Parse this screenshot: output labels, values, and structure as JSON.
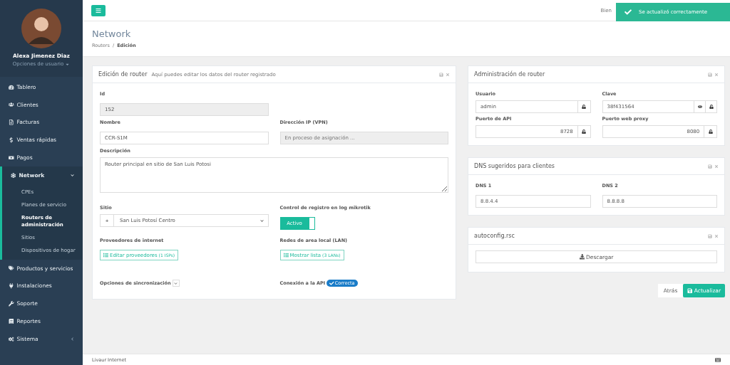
{
  "user": {
    "name": "Alexa Jimenez Diaz",
    "menu": "Opciones de usuario"
  },
  "sidebar": {
    "items": [
      {
        "label": "Tablero",
        "expanded": false
      },
      {
        "label": "Clientes",
        "expanded": false
      },
      {
        "label": "Facturas",
        "expanded": false
      },
      {
        "label": "Ventas rápidas",
        "expanded": false
      },
      {
        "label": "Pagos",
        "expanded": false
      },
      {
        "label": "Network",
        "expanded": true,
        "children": [
          {
            "label": "CPEs",
            "selected": false
          },
          {
            "label": "Planes de servicio",
            "selected": false
          },
          {
            "label": "Routers de administración",
            "selected": true
          },
          {
            "label": "Sitios",
            "selected": false
          },
          {
            "label": "Dispositivos de hogar",
            "selected": false
          }
        ]
      },
      {
        "label": "Productos y servicios",
        "expanded": false
      },
      {
        "label": "Instalaciones",
        "expanded": false
      },
      {
        "label": "Soporte",
        "expanded": false
      },
      {
        "label": "Reportes",
        "expanded": false
      },
      {
        "label": "Sistema",
        "expanded": false
      }
    ]
  },
  "topbar": {
    "greeting": "Bien"
  },
  "toast": {
    "message": "Se actualizó correctamente"
  },
  "page": {
    "title": "Network",
    "breadcrumb": {
      "parent": "Routers",
      "separator": "/",
      "current": "Edición"
    }
  },
  "edit_card": {
    "title": "Edición de router",
    "subtitle": "Aquí puedes editar los datos del router registrado",
    "id": {
      "label": "Id",
      "value": "152",
      "disabled": true
    },
    "name": {
      "label": "Nombre",
      "value": "CCR-S1M",
      "disabled": false
    },
    "ip": {
      "label": "Dirección IP (VPN)",
      "placeholder": "En proceso de asignación ...",
      "disabled": true
    },
    "description": {
      "label": "Descripción",
      "value": "Router principal en sitio de San Luis Potosi"
    },
    "site": {
      "label": "Sitio",
      "add": "+",
      "value": "San Luis Potosí Centro"
    },
    "log": {
      "label": "Control de registro en log mikrotik",
      "toggle": "Activo",
      "on": true
    },
    "isp": {
      "label": "Proveedores de internet",
      "button": "Editar proveedores",
      "count": "(1 ISPs)"
    },
    "lan": {
      "label": "Redes de area local (LAN)",
      "button": "Mostrar lista",
      "count": "(3 LANs)"
    },
    "sync": {
      "label": "Opciones de sincronización",
      "expanded": false
    },
    "api": {
      "label": "Conexión a la API",
      "status": "Correcta"
    }
  },
  "admin_card": {
    "title": "Administración de router",
    "fields": [
      {
        "label": "Usuario",
        "value": "admin",
        "kind": "text",
        "eye": false
      },
      {
        "label": "Clave",
        "value": "38f431564",
        "kind": "text",
        "eye": true
      },
      {
        "label": "Puerto de API",
        "value": "8728",
        "kind": "port",
        "eye": false
      },
      {
        "label": "Puerto web proxy",
        "value": "8080",
        "kind": "port",
        "eye": false
      }
    ]
  },
  "dns_card": {
    "title": "DNS sugeridos para clientes",
    "fields": [
      {
        "label": "DNS 1",
        "value": "8.8.4.4"
      },
      {
        "label": "DNS 2",
        "value": "8.8.8.8"
      }
    ]
  },
  "file_card": {
    "title": "autoconfig.rsc",
    "button": "Descargar"
  },
  "actions": {
    "back": "Atrás",
    "update": "Actualizar"
  },
  "footer": {
    "text": "Livaur Internet"
  }
}
